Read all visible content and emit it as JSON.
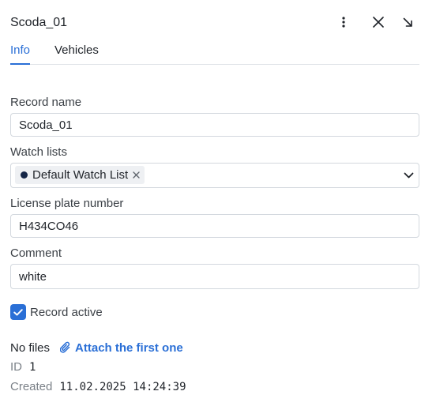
{
  "header": {
    "title": "Scoda_01",
    "icons": [
      "more-vertical-icon",
      "close-icon",
      "collapse-arrow-icon"
    ]
  },
  "tabs": [
    {
      "label": "Info",
      "active": true
    },
    {
      "label": "Vehicles",
      "active": false
    }
  ],
  "form": {
    "record_name": {
      "label": "Record name",
      "value": "Scoda_01"
    },
    "watch_lists": {
      "label": "Watch lists",
      "selected": [
        {
          "label": "Default Watch List",
          "dot_color": "#152647"
        }
      ]
    },
    "license_plate": {
      "label": "License plate number",
      "value": "H434CO46"
    },
    "comment": {
      "label": "Comment",
      "value": "white"
    },
    "record_active": {
      "label": "Record active",
      "checked": true
    }
  },
  "files": {
    "status": "No files",
    "attach_label": "Attach the first one"
  },
  "meta": {
    "id_label": "ID",
    "id_value": "1",
    "created_label": "Created",
    "created_value": "11.02.2025 14:24:39"
  },
  "colors": {
    "accent": "#2a6fd6",
    "border": "#d3d8de"
  }
}
